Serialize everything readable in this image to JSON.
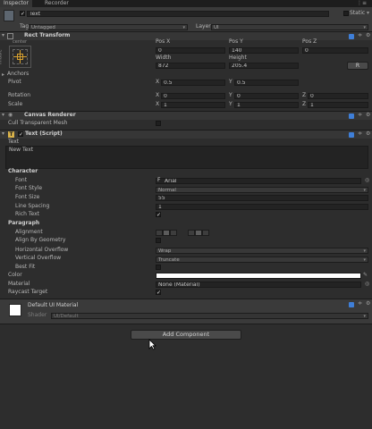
{
  "tabs": [
    "Inspector",
    "Recorder"
  ],
  "gameobject": {
    "name": "Text",
    "static_label": "Static",
    "tag_label": "Tag",
    "tag_value": "Untagged",
    "layer_label": "Layer",
    "layer_value": "UI"
  },
  "rect_transform": {
    "title": "Rect Transform",
    "anchor_preset_top": "center",
    "anchor_preset_side": "middle",
    "headers": [
      "Pos X",
      "Pos Y",
      "Pos Z"
    ],
    "pos": [
      "0",
      "140",
      "0"
    ],
    "size_headers": [
      "Width",
      "Height"
    ],
    "size": [
      "872",
      "205.4"
    ],
    "raw_button": "R",
    "anchors_label": "Anchors",
    "pivot_label": "Pivot",
    "pivot": {
      "x_label": "X",
      "x": "0.5",
      "y_label": "Y",
      "y": "0.5"
    },
    "rotation_label": "Rotation",
    "rotation": {
      "x_label": "X",
      "x": "0",
      "y_label": "Y",
      "y": "0",
      "z_label": "Z",
      "z": "0"
    },
    "scale_label": "Scale",
    "scale": {
      "x_label": "X",
      "x": "1",
      "y_label": "Y",
      "y": "1",
      "z_label": "Z",
      "z": "1"
    }
  },
  "canvas_renderer": {
    "title": "Canvas Renderer",
    "cull_label": "Cull Transparent Mesh"
  },
  "text_script": {
    "title": "Text (Script)",
    "text_label": "Text",
    "text_value": "New Text",
    "character_header": "Character",
    "font_label": "Font",
    "font_value": "Arial",
    "font_style_label": "Font Style",
    "font_style_value": "Normal",
    "font_size_label": "Font Size",
    "font_size_value": "55",
    "line_spacing_label": "Line Spacing",
    "line_spacing_value": "1",
    "rich_text_label": "Rich Text",
    "paragraph_header": "Paragraph",
    "alignment_label": "Alignment",
    "align_by_geometry_label": "Align By Geometry",
    "horizontal_overflow_label": "Horizontal Overflow",
    "horizontal_overflow_value": "Wrap",
    "vertical_overflow_label": "Vertical Overflow",
    "vertical_overflow_value": "Truncate",
    "best_fit_label": "Best Fit",
    "color_label": "Color",
    "color_value": "#ffffff",
    "material_label": "Material",
    "material_value": "None (Material)",
    "raycast_label": "Raycast Target"
  },
  "material_section": {
    "title": "Default UI Material",
    "shader_label": "Shader",
    "shader_value": "UI/Default"
  },
  "add_component_label": "Add Component",
  "accent_color": "#3f7fd8"
}
